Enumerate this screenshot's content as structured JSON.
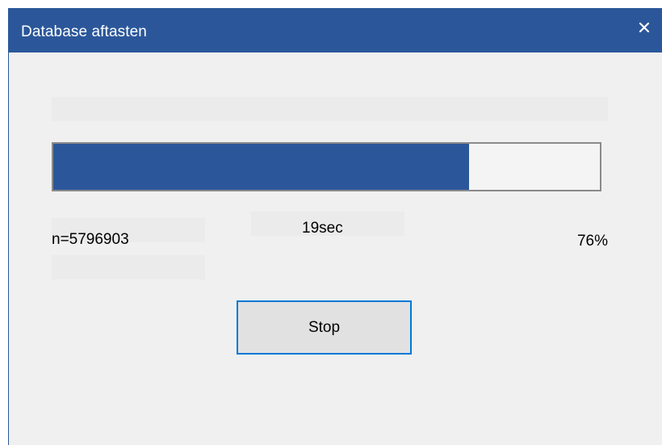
{
  "window": {
    "title": "Database aftasten",
    "close_icon": "close-icon"
  },
  "progress": {
    "percent": 76,
    "count_label": "n=5796903",
    "elapsed_label": "19sec",
    "percent_label": "76%"
  },
  "actions": {
    "stop_label": "Stop"
  },
  "colors": {
    "accent": "#2b579a",
    "focus": "#0078d7",
    "background": "#f0f0f0"
  }
}
